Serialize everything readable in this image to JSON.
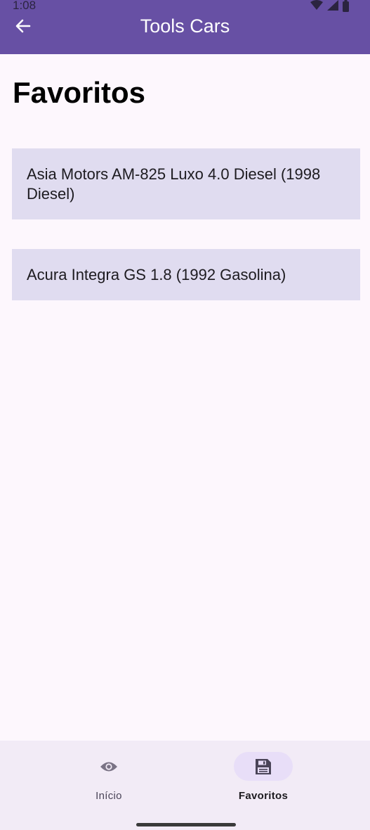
{
  "status_bar": {
    "time": "1:08",
    "icons": [
      "wifi-icon",
      "signal-icon",
      "battery-icon"
    ]
  },
  "app_bar": {
    "title": "Tools Cars",
    "back_icon": "arrow-back-icon"
  },
  "page": {
    "title": "Favoritos"
  },
  "favorites": [
    {
      "label": "Asia Motors AM-825 Luxo 4.0 Diesel (1998 Diesel)"
    },
    {
      "label": "Acura Integra GS 1.8 (1992 Gasolina)"
    }
  ],
  "bottom_nav": {
    "items": [
      {
        "label": "Início",
        "icon": "eye-icon",
        "selected": false
      },
      {
        "label": "Favoritos",
        "icon": "save-icon",
        "selected": true
      }
    ]
  },
  "colors": {
    "primary": "#6750a4",
    "background": "#fdf7fd",
    "card": "#e0dcf0",
    "nav_background": "#f2ebf6",
    "nav_indicator": "#e8def8"
  }
}
